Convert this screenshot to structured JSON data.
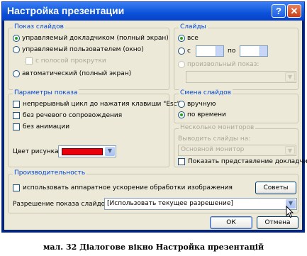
{
  "window": {
    "title": "Настройка презентации"
  },
  "show_type": {
    "title": "Показ слайдов",
    "options": [
      {
        "label": "управляемый докладчиком (полный экран)",
        "selected": true
      },
      {
        "label": "управляемый пользователем (окно)",
        "selected": false
      },
      {
        "label": "с полосой прокрутки",
        "checked": false,
        "disabled": true
      },
      {
        "label": "автоматический (полный экран)",
        "selected": false
      }
    ]
  },
  "slides": {
    "title": "Слайды",
    "all_label": "все",
    "from_label": "с",
    "to_label": "по",
    "from_value": "",
    "to_value": "",
    "custom_show_label": "произвольный показ:",
    "custom_show_value": ""
  },
  "show_options": {
    "title": "Параметры показа",
    "loop_label": "непрерывный цикл до нажатия клавиши \"Esc\"",
    "no_narration_label": "без речевого сопровождения",
    "no_animation_label": "без анимации",
    "pen_color_label": "Цвет рисунка:",
    "pen_color": "#e8000c"
  },
  "advance": {
    "title": "Смена слайдов",
    "manual_label": "вручную",
    "timings_label": "по времени"
  },
  "monitors": {
    "title": "Несколько мониторов",
    "display_label": "Выводить слайды на:",
    "display_value": "Основной монитор",
    "presenter_view_label": "Показать представление докладчика"
  },
  "performance": {
    "title": "Производительность",
    "hw_accel_label": "использовать аппаратное ускорение обработки изображения",
    "tips_label": "Советы",
    "resolution_label": "Разрешение показа слайдов:",
    "resolution_value": "[Использовать текущее разрешение]"
  },
  "buttons": {
    "ok": "ОК",
    "cancel": "Отмена"
  },
  "caption": "мал. 32 Діалогове вікно Настройка  презентацій"
}
